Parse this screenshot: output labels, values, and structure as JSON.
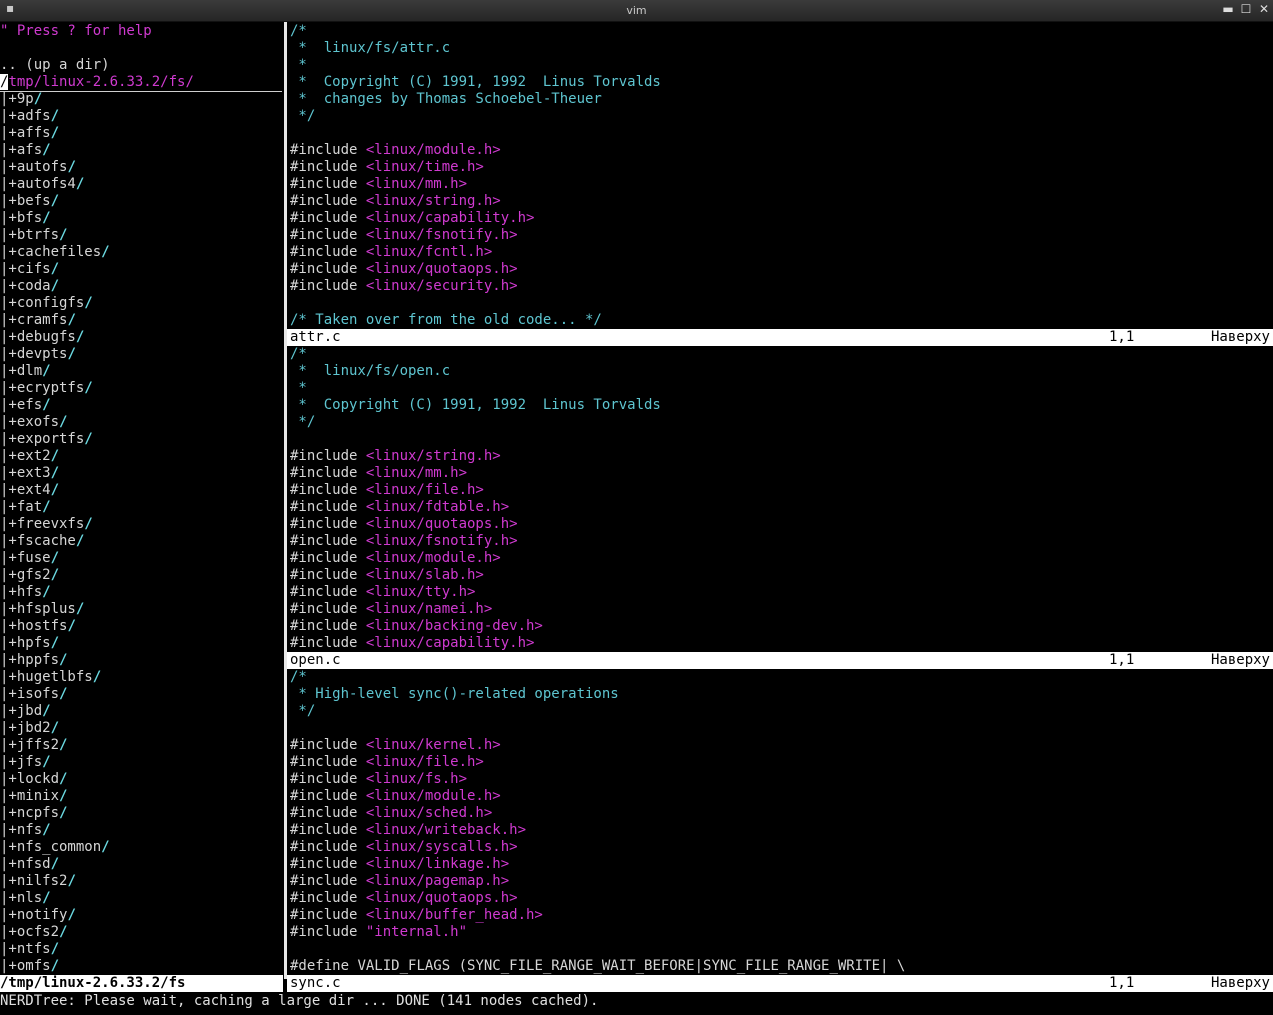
{
  "window": {
    "title": "vim",
    "menu_glyph": "▪",
    "minimize_glyph": "▬",
    "maximize_glyph": "☐",
    "close_glyph": "✕"
  },
  "nerdtree": {
    "help_hint": "\" Press ? for help",
    "up_dir": ".. (up a dir)",
    "cwd_first_char": "/",
    "cwd_rest": "tmp/linux-2.6.33.2/fs/",
    "entries": [
      "9p",
      "adfs",
      "affs",
      "afs",
      "autofs",
      "autofs4",
      "befs",
      "bfs",
      "btrfs",
      "cachefiles",
      "cifs",
      "coda",
      "configfs",
      "cramfs",
      "debugfs",
      "devpts",
      "dlm",
      "ecryptfs",
      "efs",
      "exofs",
      "exportfs",
      "ext2",
      "ext3",
      "ext4",
      "fat",
      "freevxfs",
      "fscache",
      "fuse",
      "gfs2",
      "hfs",
      "hfsplus",
      "hostfs",
      "hpfs",
      "hppfs",
      "hugetlbfs",
      "isofs",
      "jbd",
      "jbd2",
      "jffs2",
      "jfs",
      "lockd",
      "minix",
      "ncpfs",
      "nfs",
      "nfs_common",
      "nfsd",
      "nilfs2",
      "nls",
      "notify",
      "ocfs2",
      "ntfs",
      "omfs"
    ],
    "entry_prefix": "|+",
    "entry_suffix": "/",
    "status": "/tmp/linux-2.6.33.2/fs"
  },
  "panes": [
    {
      "lines": [
        {
          "t": "c",
          "text": "/*"
        },
        {
          "t": "c",
          "text": " *  linux/fs/attr.c"
        },
        {
          "t": "c",
          "text": " *"
        },
        {
          "t": "c",
          "text": " *  Copyright (C) 1991, 1992  Linus Torvalds"
        },
        {
          "t": "c",
          "text": " *  changes by Thomas Schoebel-Theuer"
        },
        {
          "t": "c",
          "text": " */"
        },
        {
          "t": "b",
          "text": ""
        },
        {
          "t": "i",
          "inc": "#include ",
          "hdr": "<linux/module.h>"
        },
        {
          "t": "i",
          "inc": "#include ",
          "hdr": "<linux/time.h>"
        },
        {
          "t": "i",
          "inc": "#include ",
          "hdr": "<linux/mm.h>"
        },
        {
          "t": "i",
          "inc": "#include ",
          "hdr": "<linux/string.h>"
        },
        {
          "t": "i",
          "inc": "#include ",
          "hdr": "<linux/capability.h>"
        },
        {
          "t": "i",
          "inc": "#include ",
          "hdr": "<linux/fsnotify.h>"
        },
        {
          "t": "i",
          "inc": "#include ",
          "hdr": "<linux/fcntl.h>"
        },
        {
          "t": "i",
          "inc": "#include ",
          "hdr": "<linux/quotaops.h>"
        },
        {
          "t": "i",
          "inc": "#include ",
          "hdr": "<linux/security.h>"
        },
        {
          "t": "b",
          "text": ""
        },
        {
          "t": "c",
          "text": "/* Taken over from the old code... */"
        }
      ],
      "status": {
        "file": "attr.c",
        "pos": "1,1",
        "where": "Наверху"
      }
    },
    {
      "lines": [
        {
          "t": "c",
          "text": "/*"
        },
        {
          "t": "c",
          "text": " *  linux/fs/open.c"
        },
        {
          "t": "c",
          "text": " *"
        },
        {
          "t": "c",
          "text": " *  Copyright (C) 1991, 1992  Linus Torvalds"
        },
        {
          "t": "c",
          "text": " */"
        },
        {
          "t": "b",
          "text": ""
        },
        {
          "t": "i",
          "inc": "#include ",
          "hdr": "<linux/string.h>"
        },
        {
          "t": "i",
          "inc": "#include ",
          "hdr": "<linux/mm.h>"
        },
        {
          "t": "i",
          "inc": "#include ",
          "hdr": "<linux/file.h>"
        },
        {
          "t": "i",
          "inc": "#include ",
          "hdr": "<linux/fdtable.h>"
        },
        {
          "t": "i",
          "inc": "#include ",
          "hdr": "<linux/quotaops.h>"
        },
        {
          "t": "i",
          "inc": "#include ",
          "hdr": "<linux/fsnotify.h>"
        },
        {
          "t": "i",
          "inc": "#include ",
          "hdr": "<linux/module.h>"
        },
        {
          "t": "i",
          "inc": "#include ",
          "hdr": "<linux/slab.h>"
        },
        {
          "t": "i",
          "inc": "#include ",
          "hdr": "<linux/tty.h>"
        },
        {
          "t": "i",
          "inc": "#include ",
          "hdr": "<linux/namei.h>"
        },
        {
          "t": "i",
          "inc": "#include ",
          "hdr": "<linux/backing-dev.h>"
        },
        {
          "t": "i",
          "inc": "#include ",
          "hdr": "<linux/capability.h>"
        }
      ],
      "status": {
        "file": "open.c",
        "pos": "1,1",
        "where": "Наверху"
      }
    },
    {
      "lines": [
        {
          "t": "c",
          "text": "/*"
        },
        {
          "t": "c",
          "text": " * High-level sync()-related operations"
        },
        {
          "t": "c",
          "text": " */"
        },
        {
          "t": "b",
          "text": ""
        },
        {
          "t": "i",
          "inc": "#include ",
          "hdr": "<linux/kernel.h>"
        },
        {
          "t": "i",
          "inc": "#include ",
          "hdr": "<linux/file.h>"
        },
        {
          "t": "i",
          "inc": "#include ",
          "hdr": "<linux/fs.h>"
        },
        {
          "t": "i",
          "inc": "#include ",
          "hdr": "<linux/module.h>"
        },
        {
          "t": "i",
          "inc": "#include ",
          "hdr": "<linux/sched.h>"
        },
        {
          "t": "i",
          "inc": "#include ",
          "hdr": "<linux/writeback.h>"
        },
        {
          "t": "i",
          "inc": "#include ",
          "hdr": "<linux/syscalls.h>"
        },
        {
          "t": "i",
          "inc": "#include ",
          "hdr": "<linux/linkage.h>"
        },
        {
          "t": "i",
          "inc": "#include ",
          "hdr": "<linux/pagemap.h>"
        },
        {
          "t": "i",
          "inc": "#include ",
          "hdr": "<linux/quotaops.h>"
        },
        {
          "t": "i",
          "inc": "#include ",
          "hdr": "<linux/buffer_head.h>"
        },
        {
          "t": "i",
          "inc": "#include ",
          "hdr": "\"internal.h\""
        },
        {
          "t": "b",
          "text": ""
        },
        {
          "t": "d",
          "inc": "#define ",
          "hdr": "VALID_FLAGS (SYNC_FILE_RANGE_WAIT_BEFORE|SYNC_FILE_RANGE_WRITE| \\"
        }
      ],
      "status": {
        "file": "sync.c",
        "pos": "1,1",
        "where": "Наверху"
      }
    }
  ],
  "command_line": "NERDTree: Please wait, caching a large dir ... DONE (141 nodes cached).",
  "colors": {
    "comment": "#5ec5d0",
    "include_path": "#d03ad0",
    "status_bg": "#ffffff",
    "background": "#000000"
  }
}
